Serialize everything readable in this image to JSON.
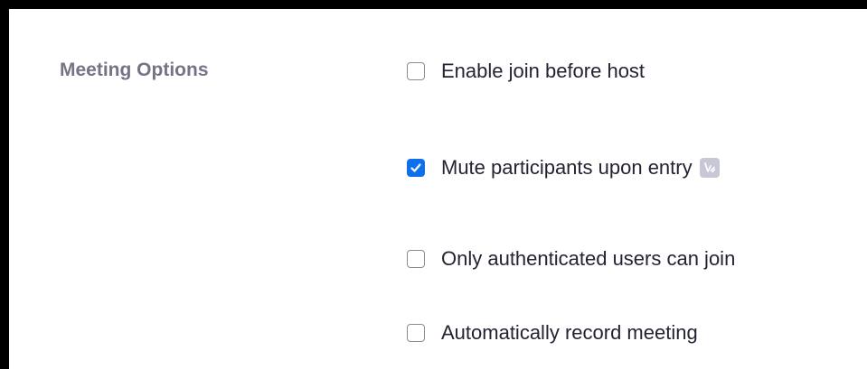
{
  "meeting_options": {
    "label": "Meeting Options",
    "options": [
      {
        "label": "Enable join before host",
        "checked": false,
        "locked": false
      },
      {
        "label": "Mute participants upon entry",
        "checked": true,
        "locked": true
      },
      {
        "label": "Only authenticated users can join",
        "checked": false,
        "locked": false
      },
      {
        "label": "Automatically record meeting",
        "checked": false,
        "locked": false
      }
    ]
  },
  "icons": {
    "check": "check-icon",
    "locked_badge": "lock-badge-icon"
  },
  "colors": {
    "accent": "#0e71eb",
    "label_gray": "#747487",
    "text": "#232333",
    "badge": "#c7c7d6"
  }
}
